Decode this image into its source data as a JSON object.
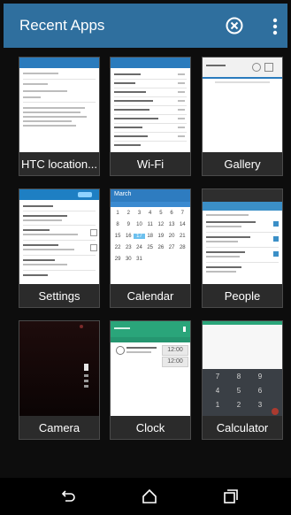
{
  "header": {
    "title": "Recent Apps"
  },
  "apps": [
    {
      "label": "HTC location..."
    },
    {
      "label": "Wi-Fi"
    },
    {
      "label": "Gallery"
    },
    {
      "label": "Settings"
    },
    {
      "label": "Calendar"
    },
    {
      "label": "People"
    },
    {
      "label": "Camera"
    },
    {
      "label": "Clock"
    },
    {
      "label": "Calculator"
    }
  ],
  "calendar_thumb": {
    "month": "March",
    "days": [
      "1",
      "2",
      "3",
      "4",
      "5",
      "6",
      "7",
      "8",
      "9",
      "10",
      "11",
      "12",
      "13",
      "14",
      "15",
      "16",
      "17",
      "18",
      "19",
      "20",
      "21",
      "22",
      "23",
      "24",
      "25",
      "26",
      "27",
      "28",
      "29",
      "30",
      "31"
    ]
  },
  "clock_thumb": {
    "time1": "12:00",
    "time2": "12:00"
  },
  "calculator_thumb": {
    "keys": [
      "7",
      "8",
      "9",
      "4",
      "5",
      "6",
      "1",
      "2",
      "3"
    ]
  },
  "colors": {
    "actionbar": "#2f6f9e",
    "settings_accent": "#1e7fc3",
    "calendar_accent": "#2e7cc0",
    "clock_accent": "#2aa57a",
    "people_accent": "#3b8fc7"
  },
  "icons": {
    "close": "close-circle-icon",
    "menu": "overflow-menu-icon",
    "back": "back-icon",
    "home": "home-icon",
    "recents": "recents-icon"
  }
}
